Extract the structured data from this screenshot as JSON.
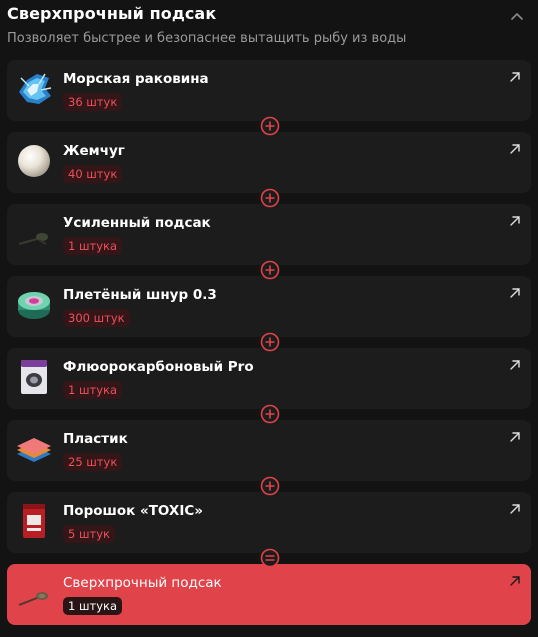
{
  "header": {
    "title": "Сверхпрочный подсак",
    "subtitle": "Позволяет быстрее и безопаснее вытащить рыбу из воды"
  },
  "ingredients": [
    {
      "name": "Морская раковина",
      "quantity": "36 штук",
      "icon": "seashell-icon"
    },
    {
      "name": "Жемчуг",
      "quantity": "40 штук",
      "icon": "pearl-icon"
    },
    {
      "name": "Усиленный подсак",
      "quantity": "1 штука",
      "icon": "landing-net-icon"
    },
    {
      "name": "Плетёный шнур 0.3",
      "quantity": "300 штук",
      "icon": "braided-line-spool-icon"
    },
    {
      "name": "Флюорокарбоновый Pro",
      "quantity": "1 штука",
      "icon": "fluorocarbon-pack-icon"
    },
    {
      "name": "Пластик",
      "quantity": "25 штук",
      "icon": "plastic-sheets-icon"
    },
    {
      "name": "Порошок «TOXIC»",
      "quantity": "5 штук",
      "icon": "powder-bag-icon"
    }
  ],
  "operators": [
    "+",
    "+",
    "+",
    "+",
    "+",
    "+",
    "="
  ],
  "result": {
    "name": "Сверхпрочный подсак",
    "quantity": "1 штука",
    "icon": "reinforced-landing-net-icon"
  },
  "colors": {
    "accent": "#e0434a",
    "badge_text": "#e8525a",
    "card_bg": "#1c1c1c",
    "panel_bg": "#131313"
  }
}
